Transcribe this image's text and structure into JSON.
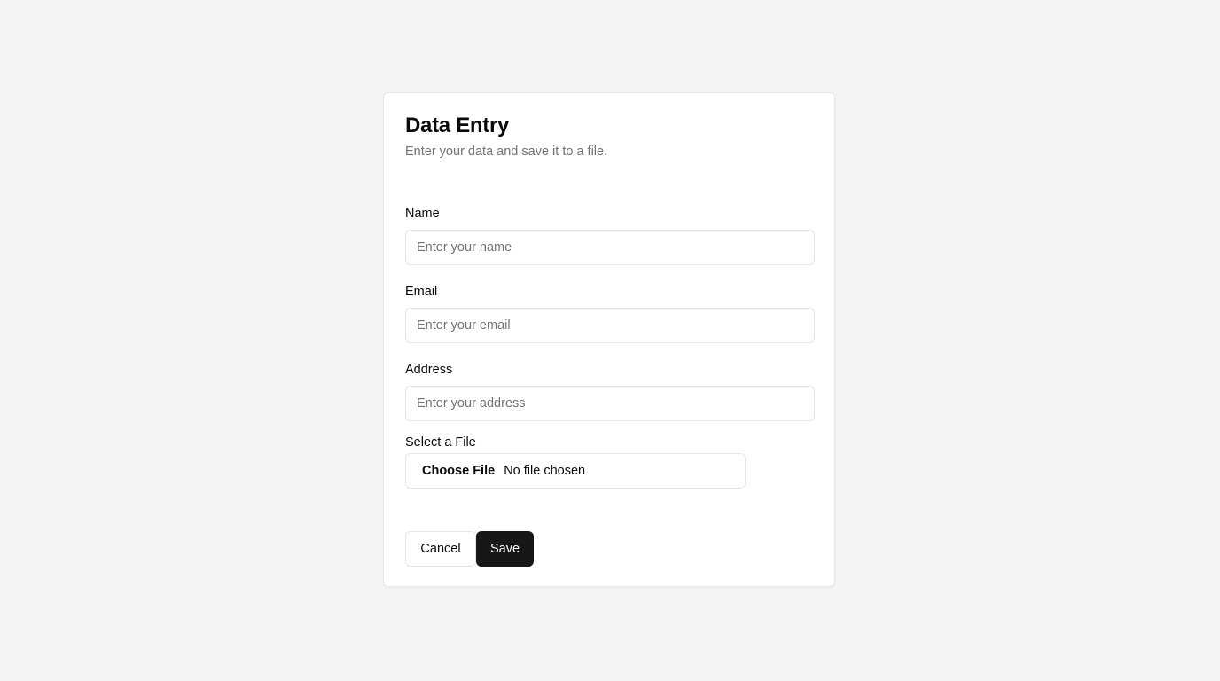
{
  "form": {
    "title": "Data Entry",
    "subtitle": "Enter your data and save it to a file.",
    "fields": {
      "name": {
        "label": "Name",
        "placeholder": "Enter your name",
        "value": ""
      },
      "email": {
        "label": "Email",
        "placeholder": "Enter your email",
        "value": ""
      },
      "address": {
        "label": "Address",
        "placeholder": "Enter your address",
        "value": ""
      }
    },
    "file": {
      "label": "Select a File",
      "button_label": "Choose File",
      "status": "No file chosen"
    },
    "actions": {
      "cancel_label": "Cancel",
      "save_label": "Save"
    }
  },
  "colors": {
    "page_background": "#f3f4f6",
    "card_background": "#ffffff",
    "primary_button": "#171717",
    "muted_text": "#737373",
    "border": "#e5e5e5"
  }
}
